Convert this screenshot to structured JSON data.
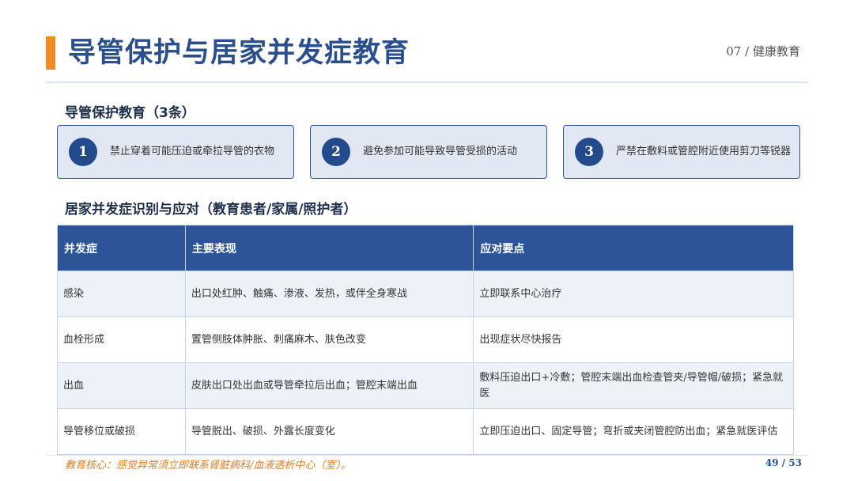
{
  "header": {
    "title": "导管保护与居家并发症教育",
    "section_tag": "07 / 健康教育"
  },
  "protection": {
    "heading": "导管保护教育（3条）",
    "items": [
      {
        "number": "1",
        "text": "禁止穿着可能压迫或牵拉导管的衣物"
      },
      {
        "number": "2",
        "text": "避免参加可能导致导管受损的活动"
      },
      {
        "number": "3",
        "text": "严禁在敷料或管腔附近使用剪刀等锐器"
      }
    ]
  },
  "complications": {
    "heading": "居家并发症识别与应对（教育患者/家属/照护者）",
    "columns": [
      "并发症",
      "主要表现",
      "应对要点"
    ],
    "rows": [
      [
        "感染",
        "出口处红肿、触痛、渗液、发热，或伴全身寒战",
        "立即联系中心治疗"
      ],
      [
        "血栓形成",
        "置管侧肢体肿胀、刺痛麻木、肤色改变",
        "出现症状尽快报告"
      ],
      [
        "出血",
        "皮肤出口处出血或导管牵拉后出血；管腔末端出血",
        "敷料压迫出口+冷敷；管腔末端出血检查管夹/导管帽/破损；紧急就医"
      ],
      [
        "导管移位或破损",
        "导管脱出、破损、外露长度变化",
        "立即压迫出口、固定导管；弯折或夹闭管腔防出血；紧急就医评估"
      ]
    ]
  },
  "footer": {
    "note": "教育核心：感觉异常须立即联系肾脏病科/血液透析中心（室）。",
    "page": "49 / 53"
  }
}
